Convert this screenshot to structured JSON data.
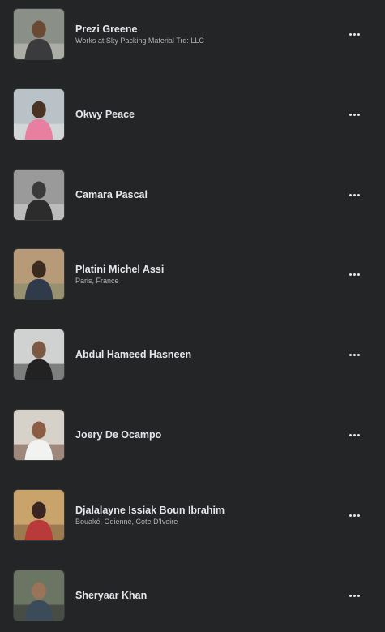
{
  "friends": [
    {
      "name": "Prezi Greene",
      "subtitle": "Works at Sky Packing Material Trd: LLC",
      "photo": {
        "bg": "#8a8f88",
        "shirt": "#3b3b3d",
        "skin": "#6b4a33",
        "accent": "#c9c7bd"
      }
    },
    {
      "name": "Okwy Peace",
      "subtitle": "",
      "photo": {
        "bg": "#b9c2c6",
        "shirt": "#e87fa0",
        "skin": "#4a3224",
        "accent": "#e7e7e4"
      }
    },
    {
      "name": "Camara Pascal",
      "subtitle": "",
      "photo": {
        "bg": "#9a9a9a",
        "shirt": "#2c2c2c",
        "skin": "#3a3a3a",
        "accent": "#d8d8d8"
      }
    },
    {
      "name": "Platini Michel Assi",
      "subtitle": "Paris, France",
      "photo": {
        "bg": "#b79a78",
        "shirt": "#2f3a4a",
        "skin": "#3a2a20",
        "accent": "#7e8a6a"
      }
    },
    {
      "name": "Abdul Hameed Hasneen",
      "subtitle": "",
      "photo": {
        "bg": "#cfd2d0",
        "shirt": "#222222",
        "skin": "#7a5a44",
        "accent": "#3b3b3b"
      }
    },
    {
      "name": "Joery De Ocampo",
      "subtitle": "",
      "photo": {
        "bg": "#d7d2c9",
        "shirt": "#f2f2f0",
        "skin": "#8a5d44",
        "accent": "#6d4a3a"
      }
    },
    {
      "name": "Djalalayne Issiak Boun Ibrahim",
      "subtitle": "Bouaké, Odienné, Cote D'Ivoire",
      "photo": {
        "bg": "#c8a46a",
        "shirt": "#b83a3a",
        "skin": "#3a2620",
        "accent": "#7a5a3a"
      }
    },
    {
      "name": "Sheryaar Khan",
      "subtitle": "",
      "photo": {
        "bg": "#6a7564",
        "shirt": "#3b4b5a",
        "skin": "#9a7358",
        "accent": "#2a2a2a"
      }
    }
  ],
  "more_label": "More options"
}
